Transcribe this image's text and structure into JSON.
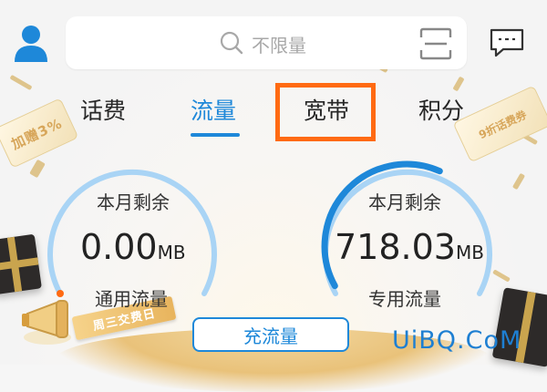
{
  "search": {
    "placeholder": "不限量"
  },
  "tabs": [
    {
      "label": "话费"
    },
    {
      "label": "流量",
      "active": true
    },
    {
      "label": "宽带",
      "highlighted": true
    },
    {
      "label": "积分"
    }
  ],
  "decorations": {
    "tag_left": "加赠3%",
    "tag_right": "9折话费券",
    "banner": "周三交费日"
  },
  "usage": {
    "general": {
      "label": "本月剩余",
      "value": "0.00",
      "unit": "MB",
      "footer": "通用流量",
      "remaining_fraction": 0.0
    },
    "dedicated": {
      "label": "本月剩余",
      "value": "718.03",
      "unit": "MB",
      "footer": "专用流量",
      "remaining_fraction": 0.6
    }
  },
  "recharge_button": "充流量",
  "watermark": "UiBQ.CoM",
  "colors": {
    "accent": "#1e88d9",
    "highlight": "#ff6a12",
    "gauge_track": "#a9d4f5"
  }
}
